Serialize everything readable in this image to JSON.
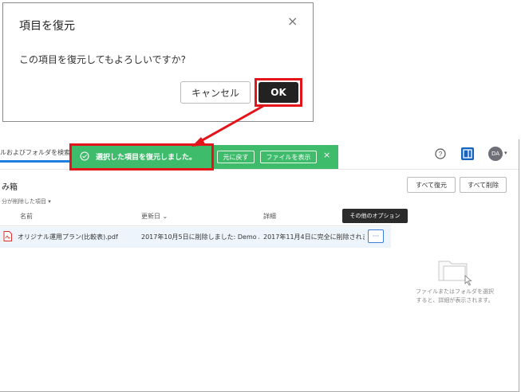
{
  "dialog": {
    "title": "項目を復元",
    "close": "×",
    "message": "この項目を復元してもよろしいですか?",
    "cancel_label": "キャンセル",
    "ok_label": "OK"
  },
  "header": {
    "search_placeholder": "ルおよびフォルダを検索",
    "help": "?",
    "avatar_initials": "DA",
    "avatar_caret": "▾"
  },
  "toast": {
    "message": "選択した項目を復元しました。",
    "undo_label": "元に戻す",
    "show_file_label": "ファイルを表示",
    "close": "×"
  },
  "page": {
    "title": "み箱",
    "breadcrumb": "分が削除した項目 ▾",
    "restore_all_label": "すべて復元",
    "delete_all_label": "すべて削除"
  },
  "table": {
    "columns": [
      "名前",
      "更新日 ⌄",
      "詳細"
    ],
    "rows": [
      {
        "name": "オリジナル運用プラン(比較表).pdf",
        "modified": "2017年10月5日に削除しました: Demo A...",
        "details": "2017年11月4日に完全に削除されま"
      }
    ],
    "more_label": "···",
    "tooltip": "その他のオプション"
  },
  "side_panel": {
    "message": "ファイルまたはフォルダを選択すると、詳細が表示されます。"
  },
  "colors": {
    "toast_green": "#3fbb6c",
    "highlight_red": "#e4141b",
    "ok_button": "#222222",
    "accent_blue": "#1565c0"
  }
}
